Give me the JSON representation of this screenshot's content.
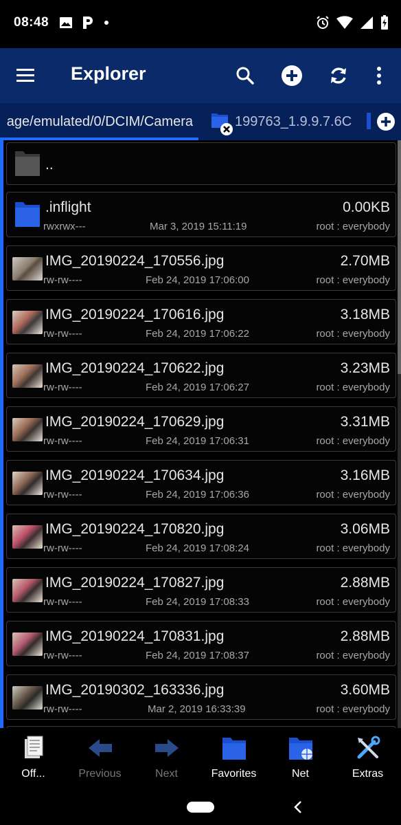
{
  "status": {
    "time": "08:48"
  },
  "toolbar": {
    "title": "Explorer"
  },
  "tabs": [
    {
      "label": "age/emulated/0/DCIM/Camera"
    },
    {
      "label": "199763_1.9.9.7.6C"
    }
  ],
  "parent": {
    "name": ".."
  },
  "files": [
    {
      "name": ".inflight",
      "size": "0.00KB",
      "perm": "rwxrwx---",
      "date": "Mar 3, 2019 15:11:19",
      "owner": "root : everybody",
      "type": "folder"
    },
    {
      "name": "IMG_20190224_170556.jpg",
      "size": "2.70MB",
      "perm": "rw-rw----",
      "date": "Feb 24, 2019 17:06:00",
      "owner": "root : everybody",
      "type": "image"
    },
    {
      "name": "IMG_20190224_170616.jpg",
      "size": "3.18MB",
      "perm": "rw-rw----",
      "date": "Feb 24, 2019 17:06:22",
      "owner": "root : everybody",
      "type": "image"
    },
    {
      "name": "IMG_20190224_170622.jpg",
      "size": "3.23MB",
      "perm": "rw-rw----",
      "date": "Feb 24, 2019 17:06:27",
      "owner": "root : everybody",
      "type": "image"
    },
    {
      "name": "IMG_20190224_170629.jpg",
      "size": "3.31MB",
      "perm": "rw-rw----",
      "date": "Feb 24, 2019 17:06:31",
      "owner": "root : everybody",
      "type": "image"
    },
    {
      "name": "IMG_20190224_170634.jpg",
      "size": "3.16MB",
      "perm": "rw-rw----",
      "date": "Feb 24, 2019 17:06:36",
      "owner": "root : everybody",
      "type": "image"
    },
    {
      "name": "IMG_20190224_170820.jpg",
      "size": "3.06MB",
      "perm": "rw-rw----",
      "date": "Feb 24, 2019 17:08:24",
      "owner": "root : everybody",
      "type": "image"
    },
    {
      "name": "IMG_20190224_170827.jpg",
      "size": "2.88MB",
      "perm": "rw-rw----",
      "date": "Feb 24, 2019 17:08:33",
      "owner": "root : everybody",
      "type": "image"
    },
    {
      "name": "IMG_20190224_170831.jpg",
      "size": "2.88MB",
      "perm": "rw-rw----",
      "date": "Feb 24, 2019 17:08:37",
      "owner": "root : everybody",
      "type": "image"
    },
    {
      "name": "IMG_20190302_163336.jpg",
      "size": "3.60MB",
      "perm": "rw-rw----",
      "date": "Mar 2, 2019 16:33:39",
      "owner": "root : everybody",
      "type": "image"
    }
  ],
  "bottom": {
    "off": "Off...",
    "previous": "Previous",
    "next": "Next",
    "favorites": "Favorites",
    "net": "Net",
    "extras": "Extras"
  },
  "colors": {
    "toolbar": "#0a2a6a",
    "tabbar": "#06205a",
    "accent": "#1e6cff",
    "folder": "#1a4fd0"
  }
}
